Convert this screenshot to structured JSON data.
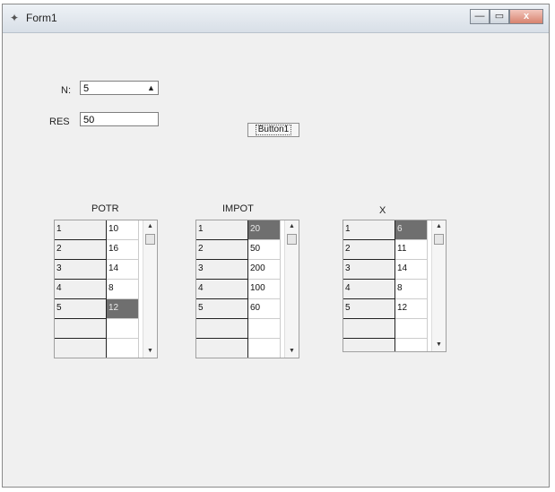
{
  "window": {
    "title": "Form1",
    "icon": "delphi-app-icon"
  },
  "titlebar_controls": {
    "minimize": "—",
    "maximize": "▭",
    "close": "x"
  },
  "form": {
    "n_label": "N:",
    "n_value": "5",
    "res_label": "RES",
    "res_value": "50",
    "button_label": "Button1"
  },
  "grids": {
    "potr": {
      "header": "POTR",
      "rows": [
        [
          "1",
          "10"
        ],
        [
          "2",
          "16"
        ],
        [
          "3",
          "14"
        ],
        [
          "4",
          "8"
        ],
        [
          "5",
          "12"
        ],
        [
          "",
          ""
        ],
        [
          "",
          ""
        ]
      ],
      "selected_row": 4
    },
    "impot": {
      "header": "IMPOT",
      "rows": [
        [
          "1",
          "20"
        ],
        [
          "2",
          "50"
        ],
        [
          "3",
          "200"
        ],
        [
          "4",
          "100"
        ],
        [
          "5",
          "60"
        ],
        [
          "",
          ""
        ],
        [
          "",
          ""
        ]
      ],
      "selected_row": 0
    },
    "x": {
      "header": "X",
      "rows": [
        [
          "1",
          "6"
        ],
        [
          "2",
          "11"
        ],
        [
          "3",
          "14"
        ],
        [
          "4",
          "8"
        ],
        [
          "5",
          "12"
        ],
        [
          "",
          ""
        ],
        [
          "",
          ""
        ]
      ],
      "selected_row": 0
    }
  }
}
